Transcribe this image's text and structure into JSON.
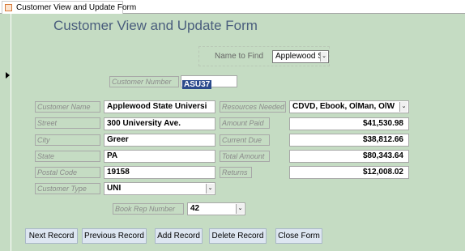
{
  "tab": {
    "label": "Customer View and Update Form",
    "icon": "form-icon"
  },
  "title": "Customer View and Update Form",
  "find": {
    "label": "Name to Find",
    "value": "Applewood S"
  },
  "customer_number": {
    "label": "Customer Number",
    "value": "ASU37"
  },
  "fields": {
    "name": {
      "label": "Customer Name",
      "value": "Applewood State Universi"
    },
    "street": {
      "label": "Street",
      "value": "300 University Ave."
    },
    "city": {
      "label": "City",
      "value": "Greer"
    },
    "state": {
      "label": "State",
      "value": "PA"
    },
    "postal": {
      "label": "Postal Code",
      "value": "19158"
    },
    "type": {
      "label": "Customer Type",
      "value": "UNI"
    },
    "resources": {
      "label": "Resources Needed",
      "value": "CDVD, Ebook, OlMan, OlW"
    },
    "amount_paid": {
      "label": "Amount Paid",
      "value": "$41,530.98"
    },
    "current_due": {
      "label": "Current Due",
      "value": "$38,812.66"
    },
    "total_amount": {
      "label": "Total Amount",
      "value": "$80,343.64"
    },
    "returns": {
      "label": "Returns",
      "value": "$12,008.02"
    },
    "book_rep": {
      "label": "Book Rep Number",
      "value": "42"
    }
  },
  "buttons": {
    "next": "Next Record",
    "previous": "Previous Record",
    "add": "Add Record",
    "delete": "Delete Record",
    "close": "Close Form"
  },
  "dropdown_glyph": "⌄",
  "colors": {
    "form_bg": "#c5dcc3",
    "title": "#4a5e7d",
    "button_bg": "#dde6f1",
    "selection": "#2b4a8c"
  }
}
